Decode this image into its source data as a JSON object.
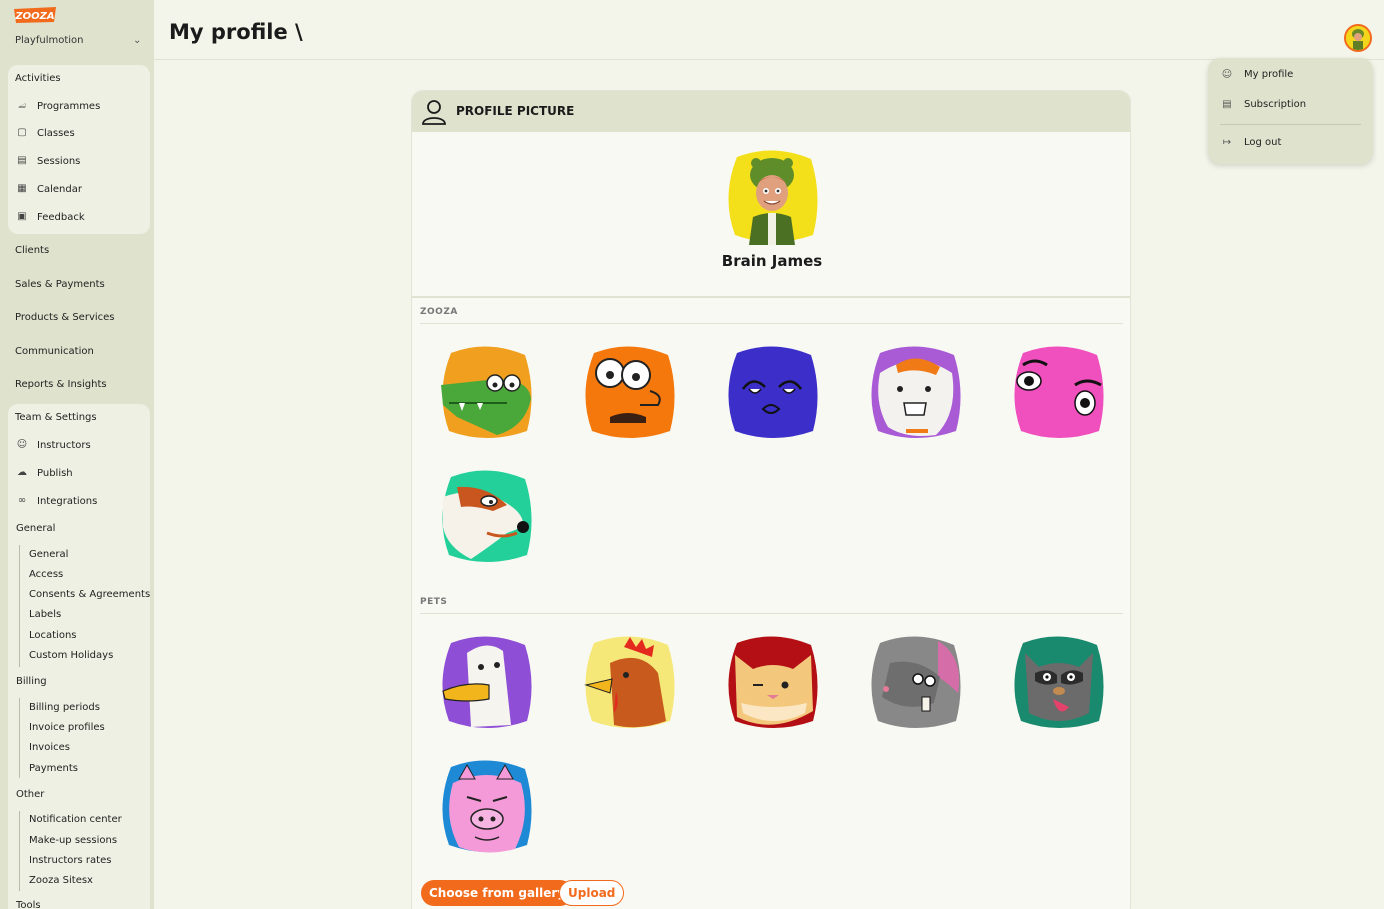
{
  "sidebar": {
    "logo_text": "ZOOZA",
    "org": "Playfulmotion",
    "activities": {
      "label": "Activities",
      "items": [
        {
          "label": "Programmes",
          "icon": "programmes-icon"
        },
        {
          "label": "Classes",
          "icon": "folder-icon"
        },
        {
          "label": "Sessions",
          "icon": "sessions-icon"
        },
        {
          "label": "Calendar",
          "icon": "calendar-icon"
        },
        {
          "label": "Feedback",
          "icon": "feedback-icon"
        }
      ]
    },
    "top_links": [
      "Clients",
      "Sales & Payments",
      "Products & Services",
      "Communication",
      "Reports & Insights"
    ],
    "team": {
      "label": "Team & Settings",
      "items": [
        {
          "label": "Instructors",
          "icon": "user-icon"
        },
        {
          "label": "Publish",
          "icon": "cloud-upload-icon"
        },
        {
          "label": "Integrations",
          "icon": "link-icon"
        }
      ],
      "general": {
        "label": "General",
        "items": [
          "General",
          "Access",
          "Consents & Agreements",
          "Labels",
          "Locations",
          "Custom Holidays"
        ]
      },
      "billing": {
        "label": "Billing",
        "items": [
          "Billing periods",
          "Invoice profiles",
          "Invoices",
          "Payments"
        ]
      },
      "other": {
        "label": "Other",
        "items": [
          "Notification center",
          "Make-up sessions",
          "Instructors rates",
          "Zooza Sitesx"
        ]
      },
      "tools_label": "Tools"
    }
  },
  "header": {
    "title": "My profile \\"
  },
  "dropdown": {
    "items": [
      {
        "label": "My profile",
        "icon": "user-icon"
      },
      {
        "label": "Subscription",
        "icon": "subscription-icon"
      },
      {
        "label": "Log out",
        "icon": "logout-icon"
      }
    ]
  },
  "profile": {
    "section_title": "PROFILE PICTURE",
    "name": "Brain James",
    "groups": [
      {
        "label": "ZOOZA",
        "avatars": [
          "crocodile-avatar",
          "mustache-face-avatar",
          "blue-face-avatar",
          "hamster-bandana-avatar",
          "pink-eyes-avatar",
          "fox-avatar"
        ]
      },
      {
        "label": "PETS",
        "avatars": [
          "duck-avatar",
          "rooster-avatar",
          "cat-avatar",
          "rat-avatar",
          "raccoon-avatar",
          "pig-avatar"
        ]
      }
    ],
    "choose_label": "Choose from gallery",
    "upload_label": "Upload"
  },
  "colors": {
    "accent": "#f26a1b",
    "sidebar": "#dfe2cd",
    "background": "#f4f5ea"
  }
}
